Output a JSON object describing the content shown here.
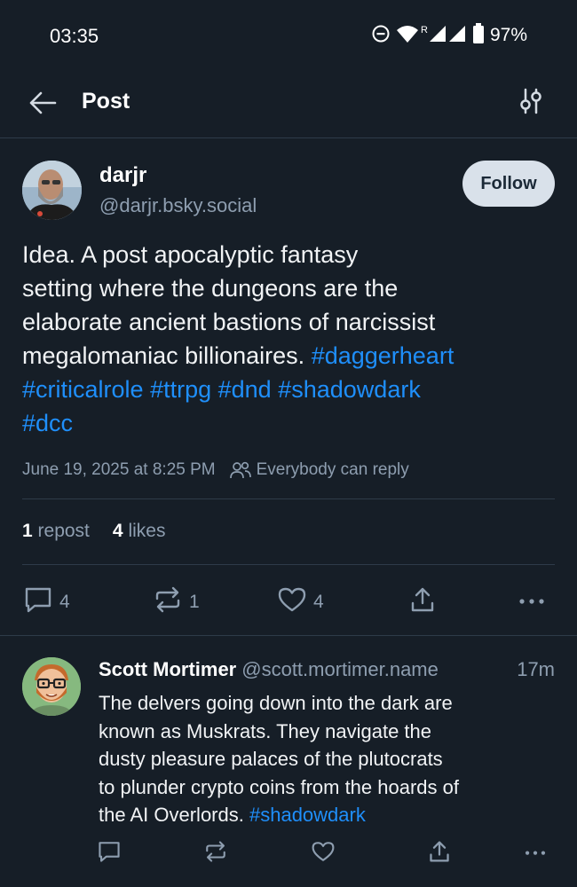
{
  "status_bar": {
    "time": "03:35",
    "battery": "97%",
    "roaming": "R"
  },
  "header": {
    "title": "Post"
  },
  "post": {
    "author": {
      "display_name": "darjr",
      "handle": "@darjr.bsky.social"
    },
    "follow_label": "Follow",
    "text_lines": [
      "Idea. A post apocalyptic fantasy",
      "setting where the dungeons are the",
      "elaborate ancient bastions of narcissist",
      "megalomaniac billionaires."
    ],
    "hashtags": [
      "#daggerheart",
      "#criticalrole",
      "#ttrpg",
      "#dnd",
      "#shadowdark",
      "#dcc"
    ],
    "timestamp": "June 19, 2025 at 8:25 PM",
    "reply_setting": "Everybody can reply",
    "reposts": {
      "count": "1",
      "label": "repost"
    },
    "likes": {
      "count": "4",
      "label": "likes"
    },
    "actions": {
      "replies": "4",
      "reposts": "1",
      "likes": "4"
    }
  },
  "reply": {
    "author": {
      "display_name": "Scott Mortimer",
      "handle": "@scott.mortimer.name"
    },
    "age": "17m",
    "text_lines": [
      "The delvers going down into the dark are",
      "known as Muskrats. They navigate the",
      "dusty pleasure palaces of the plutocrats",
      "to plunder crypto coins from the hoards of",
      "the AI Overlords."
    ],
    "hashtag": "#shadowdark"
  },
  "colors": {
    "background": "#161e27",
    "accent": "#1f8ffb",
    "muted": "#8e9eb0",
    "divider": "#2e3b49"
  },
  "icons": [
    "back-arrow-icon",
    "filter-icon",
    "reply-icon",
    "repost-icon",
    "heart-icon",
    "share-icon",
    "more-icon",
    "people-icon",
    "wifi-icon",
    "signal-icon",
    "battery-icon",
    "dnd-icon"
  ]
}
